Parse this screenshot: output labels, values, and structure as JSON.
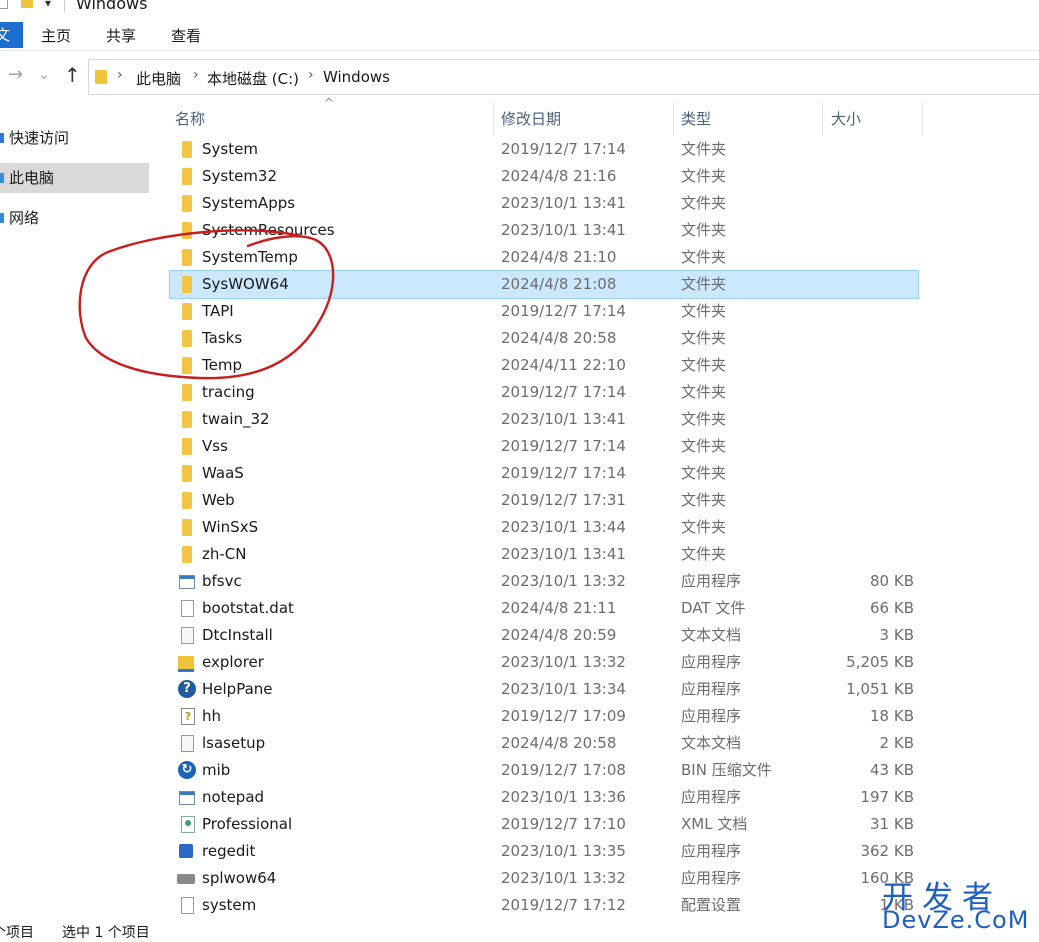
{
  "window": {
    "title": "Windows"
  },
  "ribbon": {
    "file_tab": "文件",
    "tabs": [
      "主页",
      "共享",
      "查看"
    ]
  },
  "address": {
    "crumbs": [
      "此电脑",
      "本地磁盘 (C:)",
      "Windows"
    ]
  },
  "sidebar": {
    "items": [
      {
        "label": "快速访问",
        "selected": false
      },
      {
        "label": "此电脑",
        "selected": true
      },
      {
        "label": "网络",
        "selected": false
      }
    ]
  },
  "columns": {
    "name": "名称",
    "date": "修改日期",
    "type": "类型",
    "size": "大小"
  },
  "rows": [
    {
      "name": "System",
      "date": "2019/12/7 17:14",
      "type": "文件夹",
      "size": "",
      "icon": "folder-icon"
    },
    {
      "name": "System32",
      "date": "2024/4/8 21:16",
      "type": "文件夹",
      "size": "",
      "icon": "folder-icon"
    },
    {
      "name": "SystemApps",
      "date": "2023/10/1 13:41",
      "type": "文件夹",
      "size": "",
      "icon": "folder-icon"
    },
    {
      "name": "SystemResources",
      "date": "2023/10/1 13:41",
      "type": "文件夹",
      "size": "",
      "icon": "folder-icon"
    },
    {
      "name": "SystemTemp",
      "date": "2024/4/8 21:10",
      "type": "文件夹",
      "size": "",
      "icon": "folder-icon"
    },
    {
      "name": "SysWOW64",
      "date": "2024/4/8 21:08",
      "type": "文件夹",
      "size": "",
      "icon": "folder-icon",
      "selected": true
    },
    {
      "name": "TAPI",
      "date": "2019/12/7 17:14",
      "type": "文件夹",
      "size": "",
      "icon": "folder-icon"
    },
    {
      "name": "Tasks",
      "date": "2024/4/8 20:58",
      "type": "文件夹",
      "size": "",
      "icon": "folder-icon"
    },
    {
      "name": "Temp",
      "date": "2024/4/11 22:10",
      "type": "文件夹",
      "size": "",
      "icon": "folder-icon"
    },
    {
      "name": "tracing",
      "date": "2019/12/7 17:14",
      "type": "文件夹",
      "size": "",
      "icon": "folder-icon"
    },
    {
      "name": "twain_32",
      "date": "2023/10/1 13:41",
      "type": "文件夹",
      "size": "",
      "icon": "folder-icon"
    },
    {
      "name": "Vss",
      "date": "2019/12/7 17:14",
      "type": "文件夹",
      "size": "",
      "icon": "folder-icon"
    },
    {
      "name": "WaaS",
      "date": "2019/12/7 17:14",
      "type": "文件夹",
      "size": "",
      "icon": "folder-icon"
    },
    {
      "name": "Web",
      "date": "2019/12/7 17:31",
      "type": "文件夹",
      "size": "",
      "icon": "folder-icon"
    },
    {
      "name": "WinSxS",
      "date": "2023/10/1 13:44",
      "type": "文件夹",
      "size": "",
      "icon": "folder-icon"
    },
    {
      "name": "zh-CN",
      "date": "2023/10/1 13:41",
      "type": "文件夹",
      "size": "",
      "icon": "folder-icon"
    },
    {
      "name": "bfsvc",
      "date": "2023/10/1 13:32",
      "type": "应用程序",
      "size": "80 KB",
      "icon": "app-icon"
    },
    {
      "name": "bootstat.dat",
      "date": "2024/4/8 21:11",
      "type": "DAT 文件",
      "size": "66 KB",
      "icon": "file-icon"
    },
    {
      "name": "DtcInstall",
      "date": "2024/4/8 20:59",
      "type": "文本文档",
      "size": "3 KB",
      "icon": "text-doc-icon"
    },
    {
      "name": "explorer",
      "date": "2023/10/1 13:32",
      "type": "应用程序",
      "size": "5,205 KB",
      "icon": "explorer-icon"
    },
    {
      "name": "HelpPane",
      "date": "2023/10/1 13:34",
      "type": "应用程序",
      "size": "1,051 KB",
      "icon": "help-icon"
    },
    {
      "name": "hh",
      "date": "2019/12/7 17:09",
      "type": "应用程序",
      "size": "18 KB",
      "icon": "html-help-icon"
    },
    {
      "name": "lsasetup",
      "date": "2024/4/8 20:58",
      "type": "文本文档",
      "size": "2 KB",
      "icon": "text-doc-icon"
    },
    {
      "name": "mib",
      "date": "2019/12/7 17:08",
      "type": "BIN 压缩文件",
      "size": "43 KB",
      "icon": "archive-icon"
    },
    {
      "name": "notepad",
      "date": "2023/10/1 13:36",
      "type": "应用程序",
      "size": "197 KB",
      "icon": "app-icon"
    },
    {
      "name": "Professional",
      "date": "2019/12/7 17:10",
      "type": "XML 文档",
      "size": "31 KB",
      "icon": "xml-doc-icon"
    },
    {
      "name": "regedit",
      "date": "2023/10/1 13:35",
      "type": "应用程序",
      "size": "362 KB",
      "icon": "regedit-icon"
    },
    {
      "name": "splwow64",
      "date": "2023/10/1 13:32",
      "type": "应用程序",
      "size": "160 KB",
      "icon": "printer-icon"
    },
    {
      "name": "system",
      "date": "2019/12/7 17:12",
      "type": "配置设置",
      "size": "1 KB",
      "icon": "settings-file-icon"
    }
  ],
  "status": {
    "count": "个项目",
    "selection": "选中 1 个项目"
  },
  "watermark": {
    "top": "开发者",
    "bottom": "DevZe.CoM"
  },
  "colors": {
    "selection": "#cce8ff",
    "annotation": "#c81e1e",
    "folder": "#f2c544",
    "accent": "#1a6fd1"
  }
}
